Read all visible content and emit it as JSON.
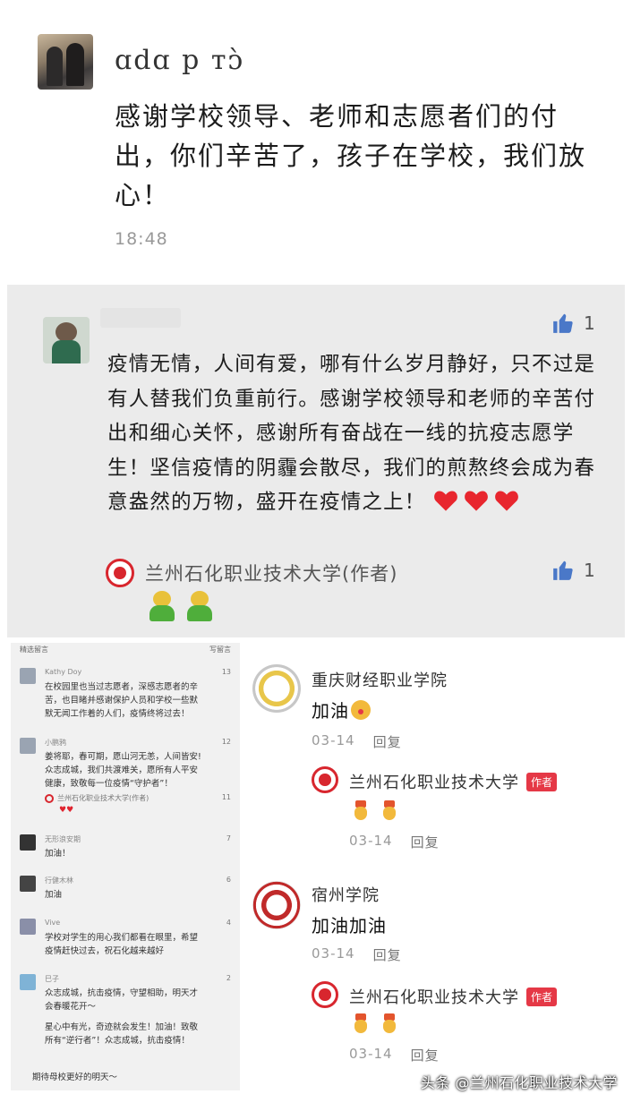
{
  "post1": {
    "username": "ɑdɑ p ᴛᴐ̀",
    "text": "感谢学校领导、老师和志愿者们的付出，你们辛苦了，孩子在学校，我们放心！",
    "time": "18:48"
  },
  "post2": {
    "likes": "1",
    "text": "疫情无情，人间有爱，哪有什么岁月静好，只不过是有人替我们负重前行。感谢学校领导和老师的辛苦付出和细心关怀，感谢所有奋战在一线的抗疫志愿学生！坚信疫情的阴霾会散尽，我们的煎熬终会成为春意盎然的万物，盛开在疫情之上！",
    "reply_name": "兰州石化职业技术大学(作者)",
    "reply_likes": "1"
  },
  "mini": {
    "top_left": "精选留言",
    "top_right": "写留言",
    "comments": [
      {
        "name": "Kathy Doy",
        "likes": "13",
        "text": "在校园里也当过志愿者，深感志愿者的辛苦，也目睹并感谢保护人员和学校一些默默无闻工作着的人们，疫情终将过去！"
      },
      {
        "name": "小鹏鸦",
        "likes": "12",
        "text": "姜将耶，春可期，愿山河无恙，人间皆安!众志成城，我们共渡难关，愿所有人平安健康，致敬每一位疫情“守护者”！",
        "reply": "兰州石化职业技术大学(作者)",
        "reply_likes": "11"
      },
      {
        "name": "无形浪安期",
        "likes": "7",
        "text": "加油！"
      },
      {
        "name": "行健木林",
        "likes": "6",
        "text": "加油"
      },
      {
        "name": "Vive",
        "likes": "4",
        "text": "学校对学生的用心我们都看在眼里，希望疫情赶快过去，祝石化越来越好"
      },
      {
        "name": "巳子",
        "likes": "2",
        "text": "众志成城，抗击疫情，守望相助，明天才会春暖花开～",
        "extra": "星心中有光，奇迹就会发生！加油！致敬所有“逆行者”！众志成城，抗击疫情！"
      }
    ],
    "bottom": "期待母校更好的明天～"
  },
  "right": {
    "c1": {
      "name": "重庆财经职业学院",
      "text": "加油",
      "date": "03-14",
      "reply_label": "回复"
    },
    "c1_reply": {
      "name": "兰州石化职业技术大学",
      "badge": "作者",
      "date": "03-14",
      "reply_label": "回复"
    },
    "c2": {
      "name": "宿州学院",
      "text": "加油加油",
      "date": "03-14",
      "reply_label": "回复"
    },
    "c2_reply": {
      "name": "兰州石化职业技术大学",
      "badge": "作者",
      "date": "03-14",
      "reply_label": "回复"
    }
  },
  "watermark": "头条 @兰州石化职业技术大学",
  "colors": {
    "brand_red": "#d8262e",
    "badge_red": "#e53846",
    "thumb_blue": "#4a78c8"
  }
}
